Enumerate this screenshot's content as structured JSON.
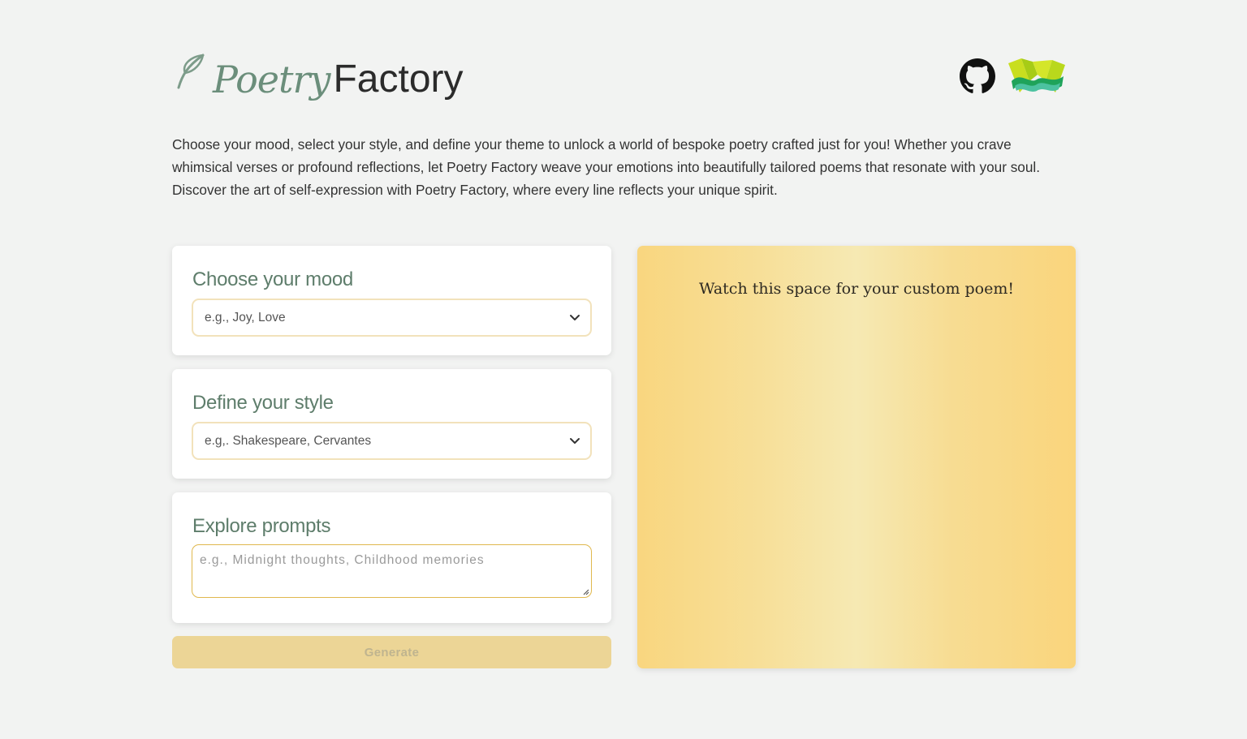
{
  "brand": {
    "italic": "Poetry",
    "plain": "Factory"
  },
  "header": {
    "icons": [
      "github-icon",
      "app-logo-icon"
    ]
  },
  "intro": "Choose your mood, select your style, and define your theme to unlock a world of bespoke poetry crafted just for you! Whether you crave whimsical verses or profound reflections, let Poetry Factory weave your emotions into beautifully tailored poems that resonate with your soul. Discover the art of self-expression with Poetry Factory, where every line reflects your unique spirit.",
  "mood": {
    "title": "Choose your mood",
    "placeholder": "e.g., Joy, Love"
  },
  "style": {
    "title": "Define your style",
    "placeholder": "e.g,. Shakespeare, Cervantes"
  },
  "prompts": {
    "title": "Explore prompts",
    "placeholder": "e.g., Midnight thoughts, Childhood memories"
  },
  "generate_label": "Generate",
  "poem": {
    "placeholder": "Watch this space for your custom poem!"
  },
  "colors": {
    "accent_green": "#6b8e7b",
    "gold": "#ecd596",
    "panel_gold": "#f9d67f"
  }
}
